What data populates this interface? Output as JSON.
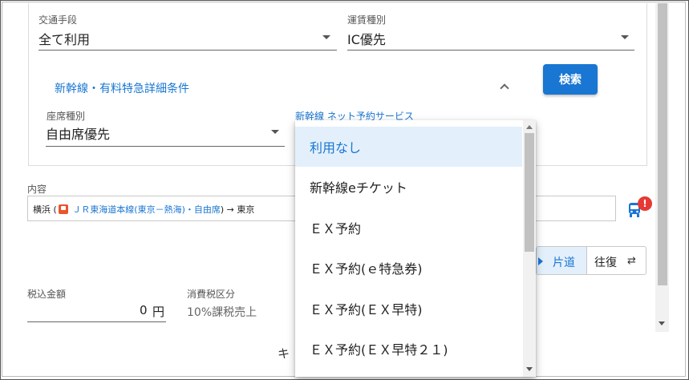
{
  "transport": {
    "label": "交通手段",
    "value": "全て利用"
  },
  "fare_type": {
    "label": "運賃種別",
    "value": "IC優先"
  },
  "shinkansen_section": {
    "title": "新幹線・有料特急詳細条件"
  },
  "search_button": {
    "label": "検索"
  },
  "seat_type": {
    "label": "座席種別",
    "value": "自由席優先"
  },
  "net_reservation": {
    "label": "新幹線 ネット予約サービス"
  },
  "content": {
    "label": "内容",
    "route_origin": "横浜 (",
    "route_line": " ＪＲ東海道本線(東京－熱海)・自由席",
    "route_tail": ") → 東京"
  },
  "alert_badge": "!",
  "trip_toggle": {
    "one_way": "片道",
    "round_trip": "往復"
  },
  "tax_amount": {
    "label": "税込金額",
    "value": "0",
    "unit": "円"
  },
  "tax_category": {
    "label": "消費税区分",
    "value": "10%課税売上"
  },
  "cancel_stub": "キ",
  "dropdown": {
    "options": [
      {
        "label": "利用なし",
        "selected": true
      },
      {
        "label": "新幹線eチケット",
        "selected": false
      },
      {
        "label": "ＥＸ予約",
        "selected": false
      },
      {
        "label": "ＥＸ予約(ｅ特急券)",
        "selected": false
      },
      {
        "label": "ＥＸ予約(ＥＸ早特)",
        "selected": false
      },
      {
        "label": "ＥＸ予約(ＥＸ早特２１)",
        "selected": false
      }
    ]
  },
  "colors": {
    "accent": "#1976d2",
    "alert": "#e53935",
    "selected_bg": "#e3f0fc"
  }
}
